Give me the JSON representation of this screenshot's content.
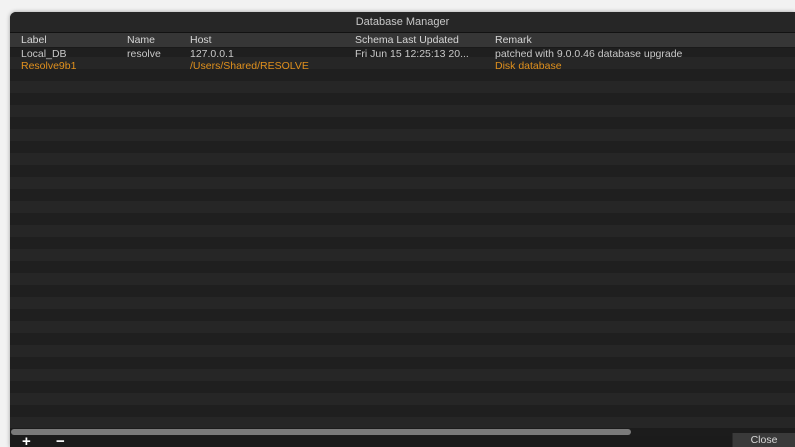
{
  "window": {
    "title": "Database Manager"
  },
  "table": {
    "columns": [
      "Label",
      "Name",
      "Host",
      "Schema Last Updated",
      "Remark"
    ],
    "rows": [
      {
        "label": "Local_DB",
        "name": "resolve",
        "host": "127.0.0.1",
        "schema_last_updated": "Fri Jun 15 12:25:13 20...",
        "remark": "patched with 9.0.0.46 database upgrade",
        "selected": false
      },
      {
        "label": "Resolve9b1",
        "name": "",
        "host": "/Users/Shared/RESOLVE",
        "schema_last_updated": "",
        "remark": "Disk database",
        "selected": true
      }
    ]
  },
  "footer": {
    "add_label": "+",
    "remove_label": "−",
    "close_label": "Close"
  },
  "colors": {
    "selected_text": "#e0901d",
    "background": "#1e1e1e"
  }
}
